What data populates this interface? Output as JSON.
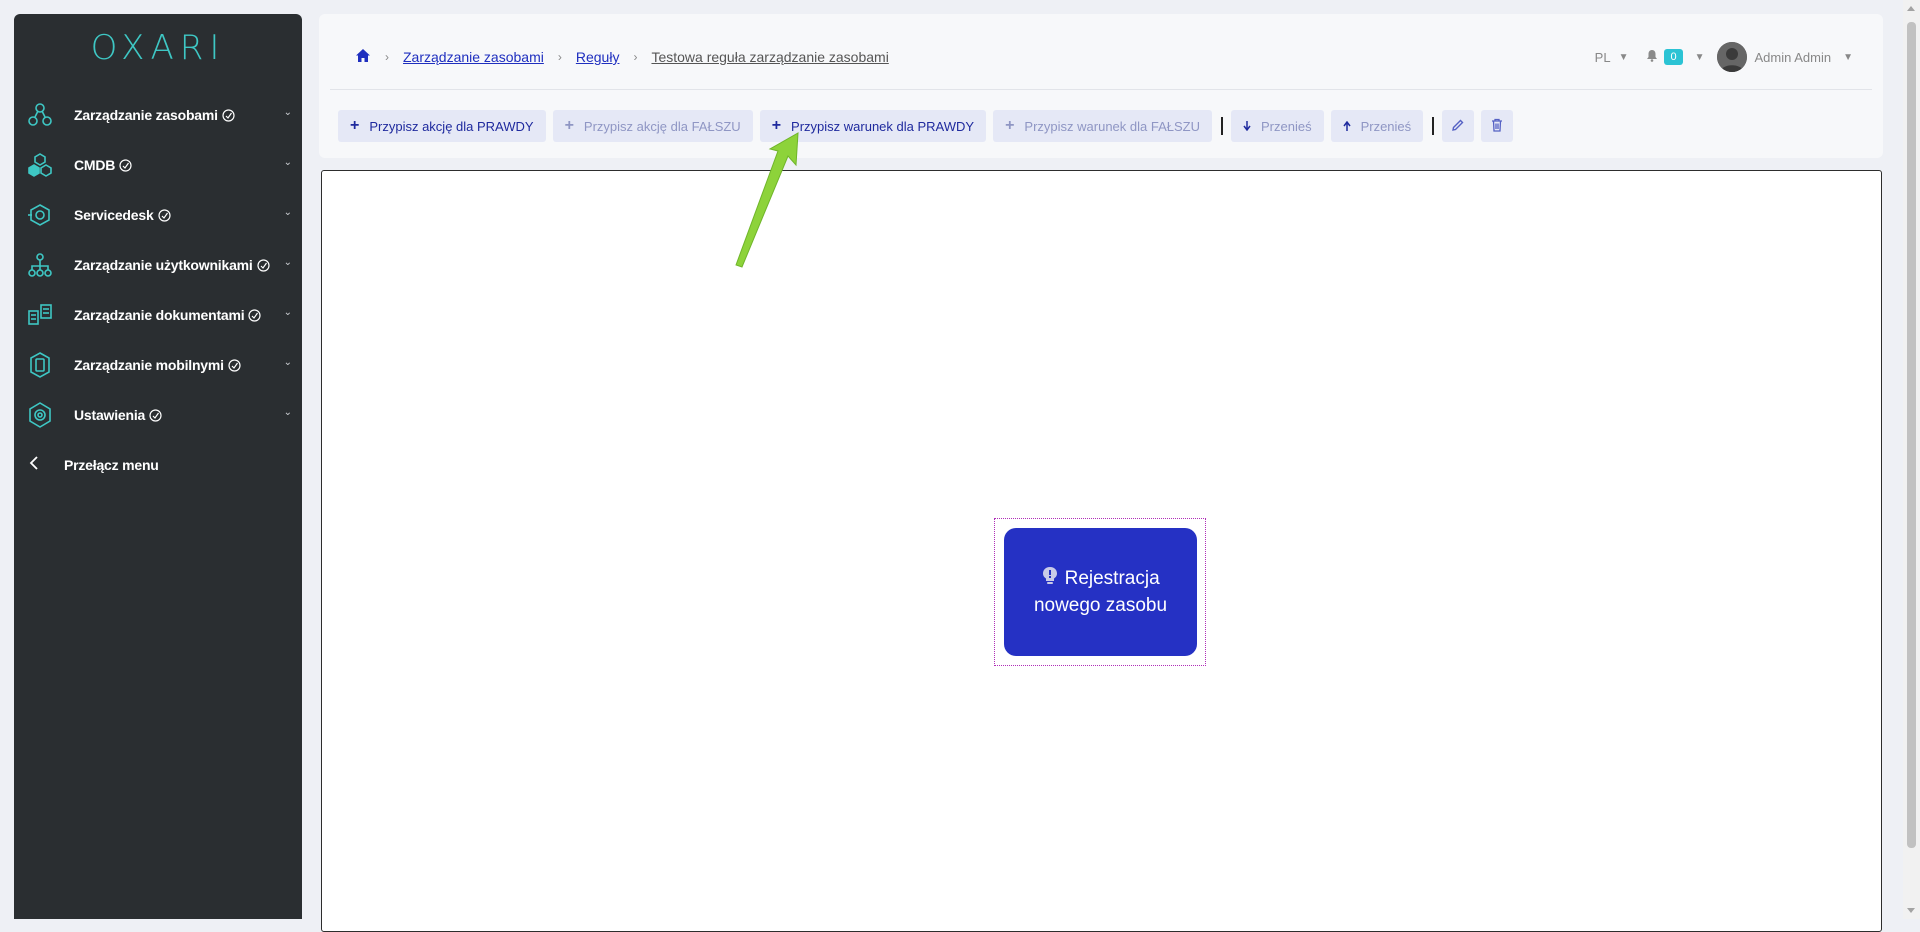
{
  "logo": {
    "text": "OXARI"
  },
  "sidebar": {
    "items": [
      {
        "label": "Zarządzanie zasobami",
        "icon": "resources-icon"
      },
      {
        "label": "CMDB",
        "icon": "cmdb-icon"
      },
      {
        "label": "Servicedesk",
        "icon": "servicedesk-icon"
      },
      {
        "label": "Zarządzanie użytkownikami",
        "icon": "users-icon"
      },
      {
        "label": "Zarządzanie dokumentami",
        "icon": "documents-icon"
      },
      {
        "label": "Zarządzanie mobilnymi",
        "icon": "mobile-icon"
      },
      {
        "label": "Ustawienia",
        "icon": "settings-icon"
      }
    ],
    "toggle_label": "Przełącz menu"
  },
  "breadcrumb": {
    "items": [
      "Zarządzanie zasobami",
      "Reguły"
    ],
    "current": "Testowa reguła zarządzanie zasobami"
  },
  "header": {
    "language": "PL",
    "notifications_count": "0",
    "user_name": "Admin Admin"
  },
  "toolbar": {
    "assign_action_true": "Przypisz akcję dla PRAWDY",
    "assign_action_false": "Przypisz akcję dla FAŁSZU",
    "assign_condition_true": "Przypisz warunek dla PRAWDY",
    "assign_condition_false": "Przypisz warunek dla FAŁSZU",
    "move_down": "Przenieś",
    "move_up": "Przenieś"
  },
  "canvas": {
    "node_line1": "Rejestracja",
    "node_line2": "nowego zasobu"
  },
  "colors": {
    "sidebar_bg": "#2a2e31",
    "accent": "#3ec7c4",
    "node_bg": "#2531c4",
    "link": "#1f2fbf",
    "annotation_arrow": "#8dd33a"
  }
}
